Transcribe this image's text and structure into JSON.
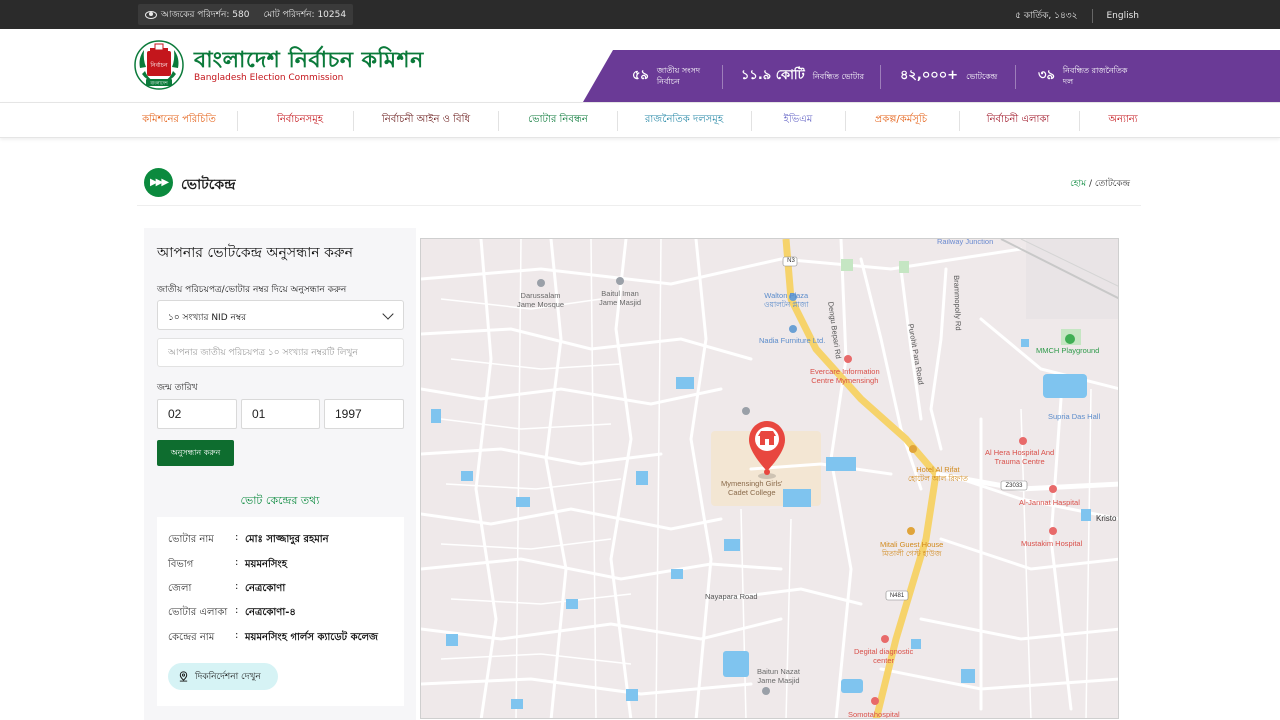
{
  "topbar": {
    "today_visits_label": "আজকের পরিদর্শন:",
    "today_visits": "580",
    "total_visits_label": "মোট পরিদর্শন:",
    "total_visits": "10254",
    "date": "৫ কার্তিক, ১৪৩২",
    "language": "English"
  },
  "header": {
    "logo_text": "নির্বাচন",
    "logo_caption": "বাংলাদেশ",
    "brand_bn": "বাংলাদেশ নির্বাচন কমিশন",
    "brand_en": "Bangladesh Election Commission",
    "stats": [
      {
        "num": "৫৯",
        "label_line1": "জাতীয় সংসদ",
        "label_line2": "নির্বাচন"
      },
      {
        "num": "১১.৯ কোটি",
        "label_line1": "নিবন্ধিত ভোটার",
        "label_line2": ""
      },
      {
        "num": "৪২,০০০+",
        "label_line1": "ভোটকেন্দ্র",
        "label_line2": ""
      },
      {
        "num": "৩৯",
        "label_line1": "নিবন্ধিত রাজনৈতিক",
        "label_line2": "দল"
      }
    ]
  },
  "nav": {
    "items": [
      {
        "label": "কমিশনের পরিচিতি",
        "color": "#e5631a"
      },
      {
        "label": "নির্বাচনসমূহ",
        "color": "#c4161c"
      },
      {
        "label": "নির্বাচনী আইন ও বিধি",
        "color": "#6b1d1d"
      },
      {
        "label": "ভোটার নিবন্ধন",
        "color": "#0b7a3a"
      },
      {
        "label": "রাজনৈতিক দলসমূহ",
        "color": "#2a8aa8"
      },
      {
        "label": "ইভিএম",
        "color": "#6a6ac8"
      },
      {
        "label": "প্রকল্প/কর্মসূচি",
        "color": "#e5631a"
      },
      {
        "label": "নির্বাচনী এলাকা",
        "color": "#a0182a"
      },
      {
        "label": "অন্যান্য",
        "color": "#c4161c"
      }
    ]
  },
  "page": {
    "title": "ভোটকেন্দ্র",
    "breadcrumb_home": "হোম",
    "breadcrumb_sep": "/",
    "breadcrumb_current": "তোটকেন্দ্র"
  },
  "search": {
    "title": "আপনার ভোটকেন্দ্র অনুসন্ধান করুন",
    "id_label": "জাতীয় পরিচয়পত্র/ভোটার নম্বর দিয়ে অনুসন্ধান করুন",
    "id_type_selected": "১০ সংখ্যার NID নম্বর",
    "nid_placeholder": "আপনার জাতীয় পরিচয়পত্র ১০ সংখ্যার নম্বরটি লিখুন",
    "dob_label": "জন্ম তারিখ",
    "dob_day": "02",
    "dob_month": "01",
    "dob_year": "1997",
    "submit_label": "অনুসন্ধান করুন"
  },
  "center_info": {
    "heading": "ভোট কেন্দ্রের তথ্য",
    "colon": ":",
    "rows": [
      {
        "key": "ভোটার নাম",
        "value": "মোঃ সাজ্জাদুর রহমান"
      },
      {
        "key": "বিভাগ",
        "value": "ময়মনসিংহ"
      },
      {
        "key": "জেলা",
        "value": "নেত্রকোণা"
      },
      {
        "key": "ভোটার এলাকা",
        "value": "নেত্রকোণা-৪"
      },
      {
        "key": "কেন্দ্রের নাম",
        "value": "ময়মনসিংহ গার্লস ক্যাডেট কলেজ"
      }
    ],
    "directions_label": "দিকনির্দেশনা দেখুন"
  },
  "map": {
    "labels": {
      "railway": "Railway Junction",
      "n3": "N3",
      "darussalam": "Darussalam\nJame Mosque",
      "baitul_iman": "Baitul Iman\nJame Masjid",
      "walton": "Walton Plaza\nওয়ালটন প্লাজা",
      "nadia": "Nadia Furniture Ltd.",
      "dengu": "Dengu Bepari Rd",
      "purohit": "Purohit Para Road",
      "brammopolly": "Brammopolly Rd",
      "mmch": "MMCH Playground",
      "evercare": "Evercare Information\nCentre Mymensingh",
      "supria": "Supria Das Hall",
      "al_hera": "Al Hera Hospital And\nTrauma Centre",
      "hotel": "Hotel Al Rifat\nহোটেল আল রিফাত",
      "z3033": "Z3033",
      "al_jannat": "Al-Jannat Haspital",
      "kristo": "Kristo",
      "college": "Mymensingh Girls'\nCadet College",
      "mustakim": "Mustakim Hospital",
      "mitali": "Mitali Guest House\nমিতালী গেস্ট হাউজ",
      "nayapara": "Nayapara Road",
      "n481": "N481",
      "degital": "Degital diagnostic\ncenter",
      "baitun": "Baitun Nazat\nJame Masjid",
      "somota": "Somotahospital"
    },
    "colors": {
      "land": "#efe9ea",
      "road": "#ffffff",
      "highway": "#f6d36b",
      "water": "#7fc4ef",
      "pin": "#e8473f",
      "green": "#0b8a3e",
      "purple": "#6a3a96"
    }
  }
}
